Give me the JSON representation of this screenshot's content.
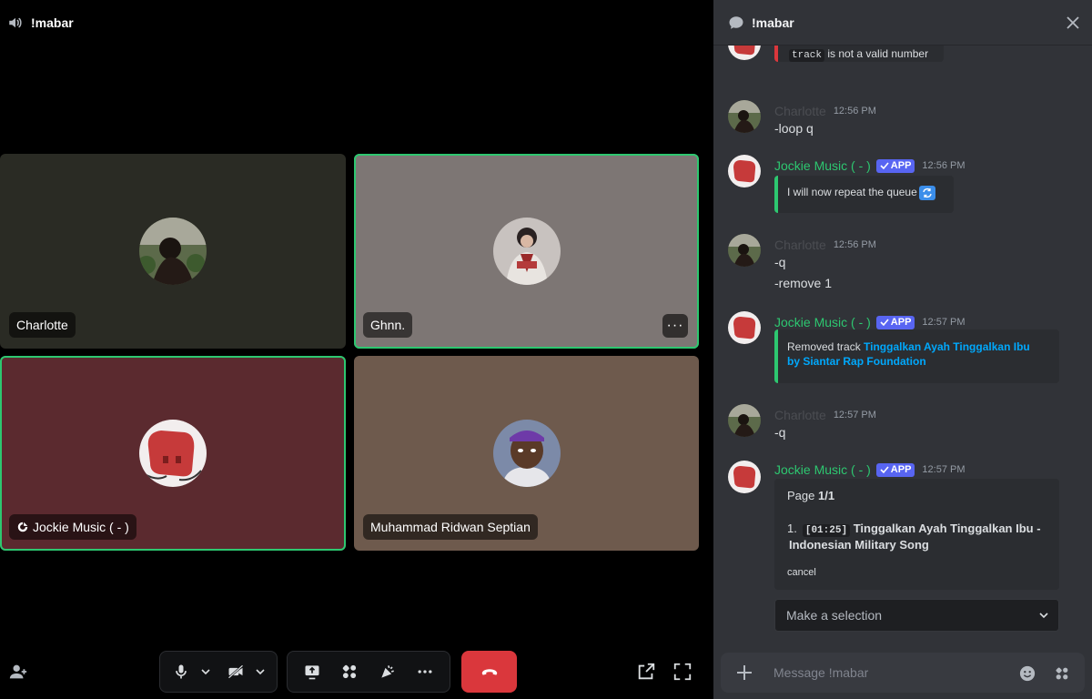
{
  "call": {
    "channel_name": "!mabar",
    "participants": [
      {
        "name": "Charlotte"
      },
      {
        "name": "Ghnn."
      },
      {
        "name": "Jockie Music ( - )"
      },
      {
        "name": "Muhammad Ridwan Septian"
      }
    ],
    "more_label": "···"
  },
  "chat": {
    "channel_name": "!mabar",
    "composer_placeholder": "Message !mabar",
    "messages": [
      {
        "embed_code": "track",
        "embed_text": " is not a valid number"
      },
      {
        "author": "Charlotte",
        "time": "12:56 PM",
        "lines": [
          "-loop q"
        ]
      },
      {
        "author": "Jockie Music ( - )",
        "badge": "APP",
        "time": "12:56 PM",
        "embed_text": "I will now repeat the queue"
      },
      {
        "author": "Charlotte",
        "time": "12:56 PM",
        "lines": [
          "-q",
          "-remove 1"
        ]
      },
      {
        "author": "Jockie Music ( - )",
        "badge": "APP",
        "time": "12:57 PM",
        "embed_prefix": "Removed track ",
        "embed_link_1": "Tinggalkan Ayah Tinggalkan Ibu",
        "embed_link_2": "by Siantar Rap Foundation"
      },
      {
        "author": "Charlotte",
        "time": "12:57 PM",
        "lines": [
          "-q"
        ]
      },
      {
        "author": "Jockie Music ( - )",
        "badge": "APP",
        "time": "12:57 PM",
        "page_label": "Page ",
        "page_value": "1/1",
        "queue_number": "1.",
        "queue_duration": "[01:25]",
        "queue_title_1": "Tinggalkan Ayah Tinggalkan Ibu -",
        "queue_title_2": "Indonesian Military Song",
        "cancel_label": "cancel",
        "select_placeholder": "Make a selection"
      }
    ]
  },
  "colors": {
    "accent_green": "#2dc770",
    "hangup_red": "#da373c",
    "app_badge": "#5865f2",
    "link": "#00a8fc"
  },
  "icons": [
    "speaker-icon",
    "chat-bubble-icon",
    "close-icon",
    "microphone-icon",
    "camera-off-icon",
    "screen-share-icon",
    "activities-icon",
    "soundboard-icon",
    "more-icon",
    "hangup-icon",
    "popout-icon",
    "fullscreen-icon",
    "add-user-icon",
    "plus-icon",
    "emoji-icon",
    "apps-icon",
    "chevron-down-icon",
    "checkmark-icon",
    "repeat-icon"
  ]
}
